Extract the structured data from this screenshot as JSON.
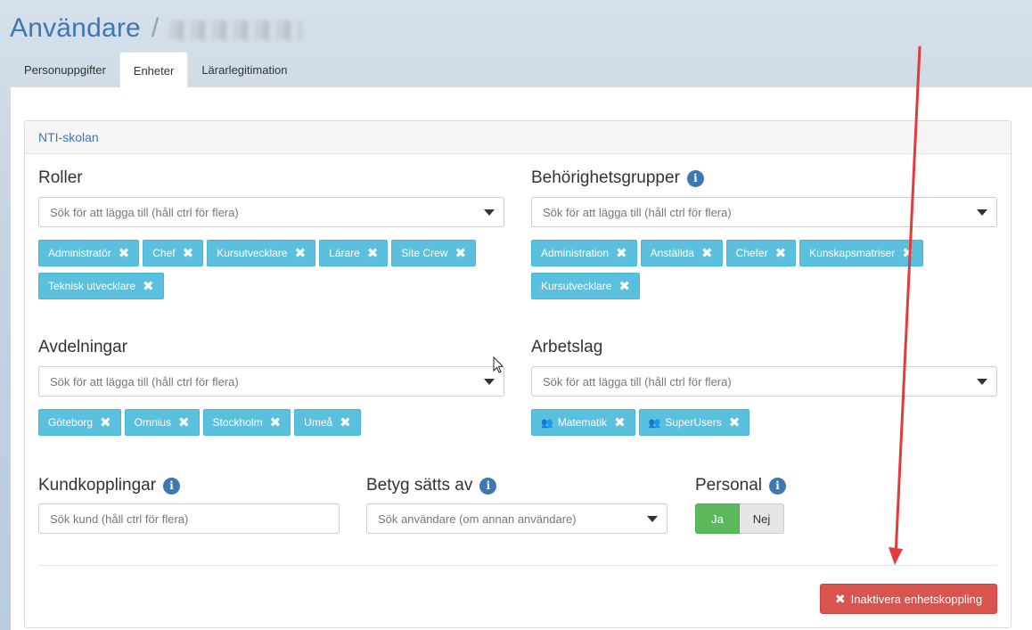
{
  "header": {
    "title": "Användare",
    "separator": "/"
  },
  "tabs": [
    {
      "label": "Personuppgifter",
      "active": false
    },
    {
      "label": "Enheter",
      "active": true
    },
    {
      "label": "Lärarlegitimation",
      "active": false
    }
  ],
  "unit": {
    "name": "NTI-skolan"
  },
  "roller": {
    "label": "Roller",
    "placeholder": "Sök för att lägga till (håll ctrl för flera)",
    "tags": [
      "Administratör",
      "Chef",
      "Kursutvecklare",
      "Lärare",
      "Site Crew",
      "Teknisk utvecklare"
    ]
  },
  "behorighetsgrupper": {
    "label": "Behörighetsgrupper",
    "placeholder": "Sök för att lägga till (håll ctrl för flera)",
    "tags": [
      "Administration",
      "Anställda",
      "Chefer",
      "Kunskapsmatriser",
      "Kursutvecklare"
    ]
  },
  "avdelningar": {
    "label": "Avdelningar",
    "placeholder": "Sök för att lägga till (håll ctrl för flera)",
    "tags": [
      "Göteborg",
      "Omnius",
      "Stockholm",
      "Umeå"
    ]
  },
  "arbetslag": {
    "label": "Arbetslag",
    "placeholder": "Sök för att lägga till (håll ctrl för flera)",
    "tags": [
      "Matematik",
      "SuperUsers"
    ]
  },
  "kundkopplingar": {
    "label": "Kundkopplingar",
    "placeholder": "Sök kund (håll ctrl för flera)"
  },
  "betyg": {
    "label": "Betyg sätts av",
    "placeholder": "Sök användare (om annan användare)"
  },
  "personal": {
    "label": "Personal",
    "yes": "Ja",
    "no": "Nej",
    "selected": "Ja"
  },
  "actions": {
    "deactivate_label": "Inaktivera enhetskoppling"
  },
  "colors": {
    "accent": "#3d78b4",
    "tag": "#5bc0de",
    "success": "#5cb85c",
    "danger": "#d9534f",
    "annotation_arrow": "#e03c3c"
  },
  "icons": {
    "info": "info-icon",
    "remove": "close-icon",
    "group": "users-icon",
    "caret": "caret-down-icon"
  }
}
